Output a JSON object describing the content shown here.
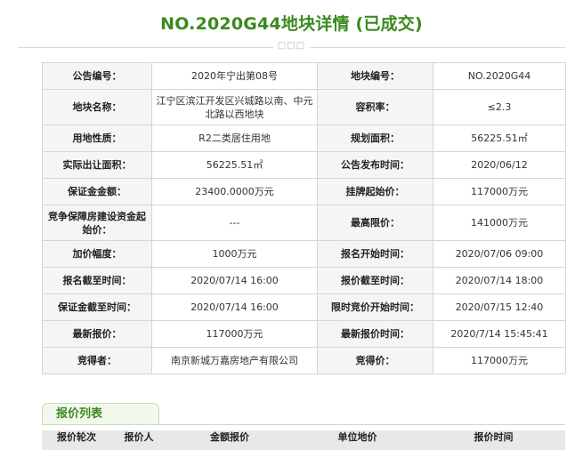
{
  "page": {
    "title": "NO.2020G44地块详情 (已成交)",
    "separator_mark": "□□□"
  },
  "details": {
    "rows": [
      [
        {
          "label": "公告编号：",
          "value": "2020年宁出第08号"
        },
        {
          "label": "地块编号：",
          "value": "NO.2020G44"
        }
      ],
      [
        {
          "label": "地块名称：",
          "value": "江宁区滨江开发区兴城路以南、中元北路以西地块"
        },
        {
          "label": "容积率：",
          "value": "≤2.3"
        }
      ],
      [
        {
          "label": "用地性质：",
          "value": "R2二类居住用地"
        },
        {
          "label": "规划面积：",
          "value": "56225.51㎡"
        }
      ],
      [
        {
          "label": "实际出让面积：",
          "value": "56225.51㎡"
        },
        {
          "label": "公告发布时间：",
          "value": "2020/06/12"
        }
      ],
      [
        {
          "label": "保证金金额：",
          "value": "23400.0000万元"
        },
        {
          "label": "挂牌起始价：",
          "value": "117000万元"
        }
      ],
      [
        {
          "label": "竞争保障房建设资金起始价：",
          "value": "---"
        },
        {
          "label": "最高限价：",
          "value": "141000万元"
        }
      ],
      [
        {
          "label": "加价幅度：",
          "value": "1000万元"
        },
        {
          "label": "报名开始时间：",
          "value": "2020/07/06 09:00"
        }
      ],
      [
        {
          "label": "报名截至时间：",
          "value": "2020/07/14 16:00"
        },
        {
          "label": "报价截至时间：",
          "value": "2020/07/14 18:00"
        }
      ],
      [
        {
          "label": "保证金截至时间：",
          "value": "2020/07/14 16:00"
        },
        {
          "label": "限时竞价开始时间：",
          "value": "2020/07/15 12:40"
        }
      ],
      [
        {
          "label": "最新报价：",
          "value": "117000万元"
        },
        {
          "label": "最新报价时间：",
          "value": "2020/7/14 15:45:41"
        }
      ],
      [
        {
          "label": "竞得者：",
          "value": "南京新城万嘉房地产有限公司"
        },
        {
          "label": "竞得价：",
          "value": "117000万元"
        }
      ]
    ]
  },
  "colors": {
    "accent_green": "#3a8a1f",
    "highlight_red": "#d9302a"
  },
  "quote_list": {
    "title": "报价列表",
    "headers": [
      "报价轮次",
      "报价人",
      "金额报价",
      "单位地价",
      "报价时间"
    ]
  }
}
